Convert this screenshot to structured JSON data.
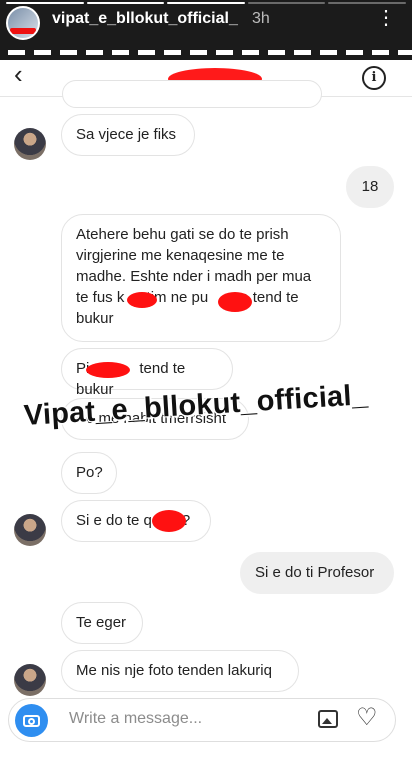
{
  "story": {
    "username": "vipat_e_bllokut_official_",
    "time": "3h",
    "more_icon": "more-vertical-icon"
  },
  "dm": {
    "back_icon": "chevron-left-icon",
    "info_icon": "info-icon",
    "info_glyph": "i"
  },
  "messages": {
    "m1": "Sa vjece je fiks",
    "m2": "18",
    "m3_line1": "Atehere behu gati se do te prish",
    "m3_line2": "virgjerine me kenaqesine me te",
    "m3_line3": "madhe. Eshte nder i madh per mua",
    "m3_line4": "te fus k",
    "m3_line4b": " tim ne pu",
    "m3_line4c": "a tend te",
    "m3_line5": "bukur",
    "m4_prefix": "Pi",
    "m4_suffix": "tend te bukur",
    "m5": "Po me habit tmerrsisht",
    "m6": "Po?",
    "m7_prefix": "Si e do te q",
    "m7_suffix": "?",
    "m8": "Si e do ti Profesor",
    "m9": "Te eger",
    "m10": "Me nis nje foto tenden lakuriq"
  },
  "watermark": "Vipat_e_bllokut_official_",
  "composer": {
    "placeholder": "Write a message...",
    "camera_icon": "camera-icon",
    "gallery_icon": "gallery-icon",
    "heart_icon": "heart-icon",
    "heart_glyph": "♡"
  },
  "colors": {
    "redaction": "#ff1111",
    "camera_button": "#2f8ef0",
    "sent_bubble": "#efefef"
  }
}
